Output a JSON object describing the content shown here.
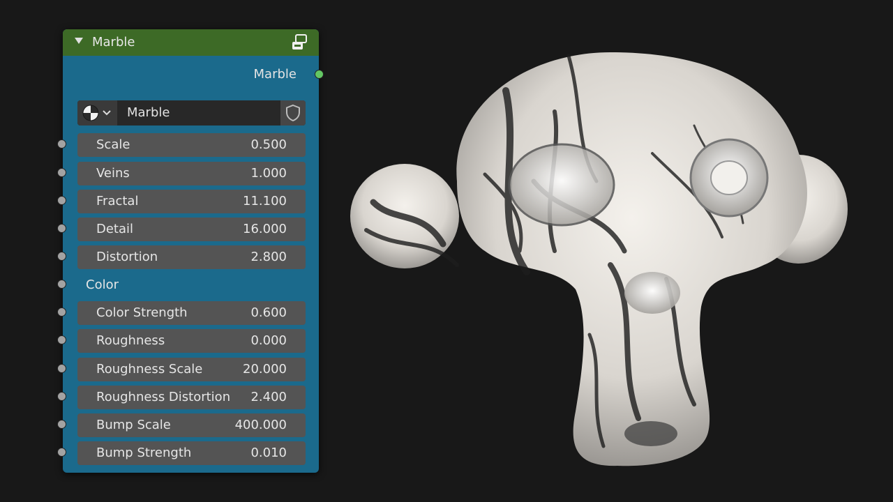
{
  "node": {
    "title": "Marble",
    "output_label": "Marble",
    "selector_name": "Marble",
    "group_label": "Color",
    "colors": {
      "header": "#3d6a26",
      "body": "#1b6a8c",
      "output_socket": "#63c763",
      "input_socket": "#a3a3a3"
    },
    "icons": {
      "collapse": "chevron-down-icon",
      "group": "node-group-icon",
      "material": "material-sphere-icon",
      "fake_user": "shield-icon"
    },
    "inputs_a": [
      {
        "label": "Scale",
        "value": "0.500"
      },
      {
        "label": "Veins",
        "value": "1.000"
      },
      {
        "label": "Fractal",
        "value": "11.100"
      },
      {
        "label": "Detail",
        "value": "16.000"
      },
      {
        "label": "Distortion",
        "value": "2.800"
      }
    ],
    "inputs_b": [
      {
        "label": "Color Strength",
        "value": "0.600"
      },
      {
        "label": "Roughness",
        "value": "0.000"
      },
      {
        "label": "Roughness Scale",
        "value": "20.000"
      },
      {
        "label": "Roughness Distortion",
        "value": "2.400"
      },
      {
        "label": "Bump Scale",
        "value": "400.000"
      },
      {
        "label": "Bump Strength",
        "value": "0.010"
      }
    ]
  }
}
